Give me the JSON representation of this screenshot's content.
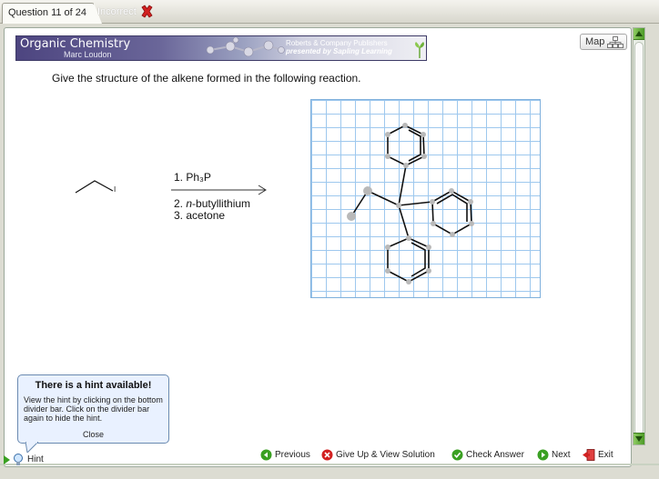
{
  "tab": {
    "label": "Question 11 of 24",
    "status": "Incorrect"
  },
  "banner": {
    "title": "Organic Chemistry",
    "author": "Marc Loudon",
    "publisher_line1": "Roberts & Company Publishers",
    "publisher_line2": "presented by Sapling Learning"
  },
  "map": {
    "label": "Map"
  },
  "question": {
    "text": "Give the structure of the alkene formed in the following reaction."
  },
  "reaction": {
    "reagent_label": "I",
    "step1": "1. Ph₃P",
    "step2_num": "2. ",
    "step2_reagent": "n",
    "step2_rest": "-butyllithium",
    "step3": "3. acetone"
  },
  "hint_popup": {
    "title": "There is a hint available!",
    "body": "View the hint by clicking on the bottom divider bar. Click on the divider bar again to hide the hint.",
    "close": "Close"
  },
  "footer": {
    "hint": "Hint",
    "previous": "Previous",
    "give_up": "Give Up & View Solution",
    "check": "Check Answer",
    "next": "Next",
    "exit": "Exit"
  },
  "colors": {
    "accent_green": "#3aa022",
    "incorrect_red": "#d22020",
    "grid_blue": "#9ec8ee"
  }
}
